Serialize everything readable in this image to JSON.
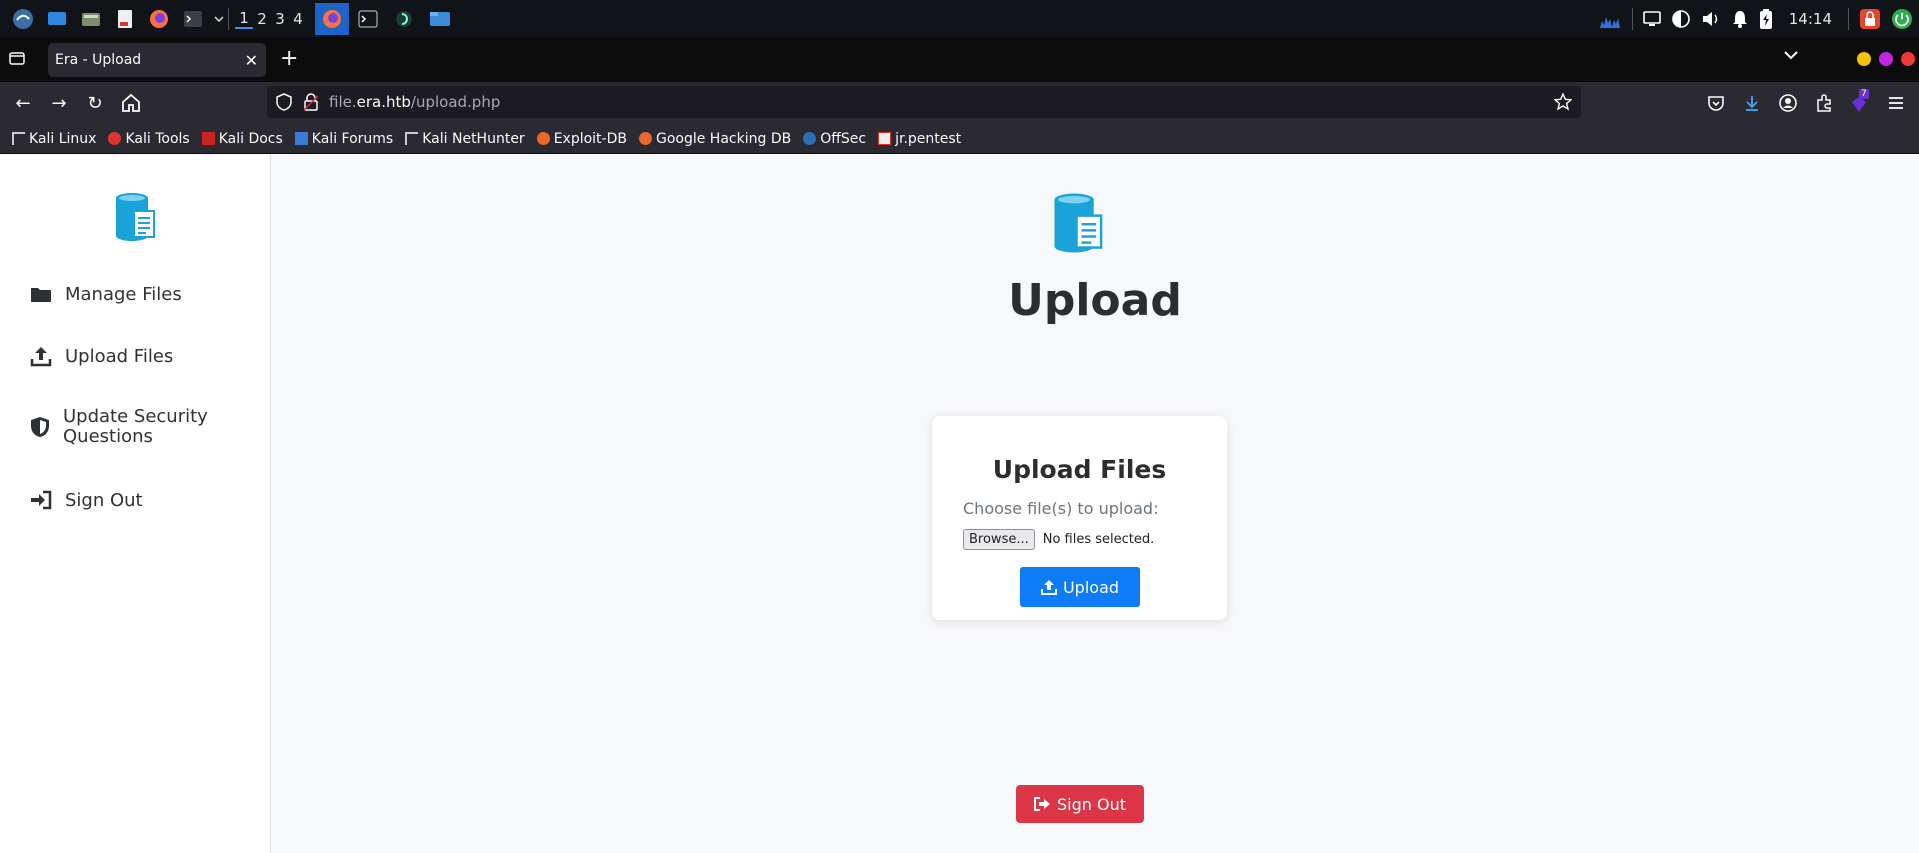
{
  "taskbar": {
    "workspaces": [
      "1",
      "2",
      "3",
      "4"
    ],
    "clock": "14:14"
  },
  "browser": {
    "tab_title": "Era - Upload",
    "url_prefix": "file.",
    "url_host": "era.htb",
    "url_path": "/upload.php",
    "bookmarks": [
      "Kali Linux",
      "Kali Tools",
      "Kali Docs",
      "Kali Forums",
      "Kali NetHunter",
      "Exploit-DB",
      "Google Hacking DB",
      "OffSec",
      "jr.pentest"
    ],
    "extension_badge": "7"
  },
  "sidebar": {
    "items": [
      {
        "label": "Manage Files",
        "icon": "folder-icon"
      },
      {
        "label": "Upload Files",
        "icon": "upload-icon"
      },
      {
        "label": "Update Security Questions",
        "icon": "shield-icon"
      },
      {
        "label": "Sign Out",
        "icon": "sign-in-icon"
      }
    ]
  },
  "main": {
    "title": "Upload",
    "card": {
      "title": "Upload Files",
      "label": "Choose file(s) to upload:",
      "browse_label": "Browse...",
      "file_status": "No files selected.",
      "upload_label": "Upload"
    },
    "signout_label": "Sign Out"
  },
  "colors": {
    "primary": "#0d7cf6",
    "danger": "#dc3545",
    "logo": "#1aa3d9"
  }
}
